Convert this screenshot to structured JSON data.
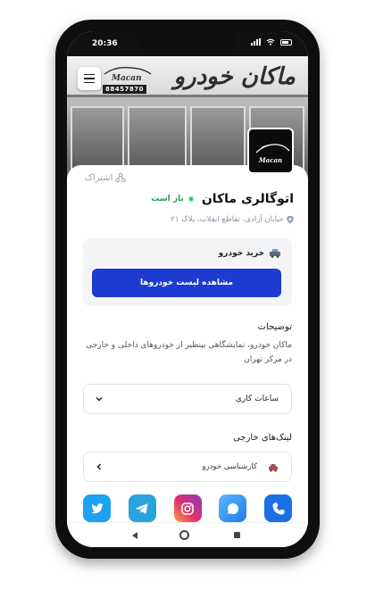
{
  "status": {
    "time": "20:36"
  },
  "hero": {
    "sign_title": "ماکان خودرو",
    "sign_logo_text": "Macan",
    "sign_phone": "88457870"
  },
  "brand": {
    "logo_text": "Macan"
  },
  "header": {
    "share_label": "اشتراک",
    "title": "اتوگالری ماکان",
    "open_status": "باز است",
    "address": "خیابان آزادی، تقاطع انقلاب، پلاک ۲۱"
  },
  "buy": {
    "heading": "خرید خودرو",
    "button_label": "مشاهده لیست خودروها"
  },
  "description": {
    "title": "توضیحات",
    "text": "ماکان خودرو، نمایشگاهی بینظیر از خودروهای داخلی و خارجی در مرکز تهران"
  },
  "hours": {
    "label": "ساعات کاری"
  },
  "links": {
    "title": "لینک‌های خارجی",
    "items": [
      {
        "label": "کارشناسی خودرو"
      }
    ]
  },
  "socials": [
    {
      "icon": "twitter-icon",
      "color": "#1da1f2"
    },
    {
      "icon": "telegram-icon",
      "color": "#2aa3dc"
    },
    {
      "icon": "instagram-icon",
      "color": "#d6249f"
    },
    {
      "icon": "message-icon",
      "color": "#1e90ff"
    },
    {
      "icon": "phone-icon",
      "color": "#1d6fe6"
    }
  ],
  "colors": {
    "primary": "#1d3ccf",
    "open": "#22a35a"
  }
}
